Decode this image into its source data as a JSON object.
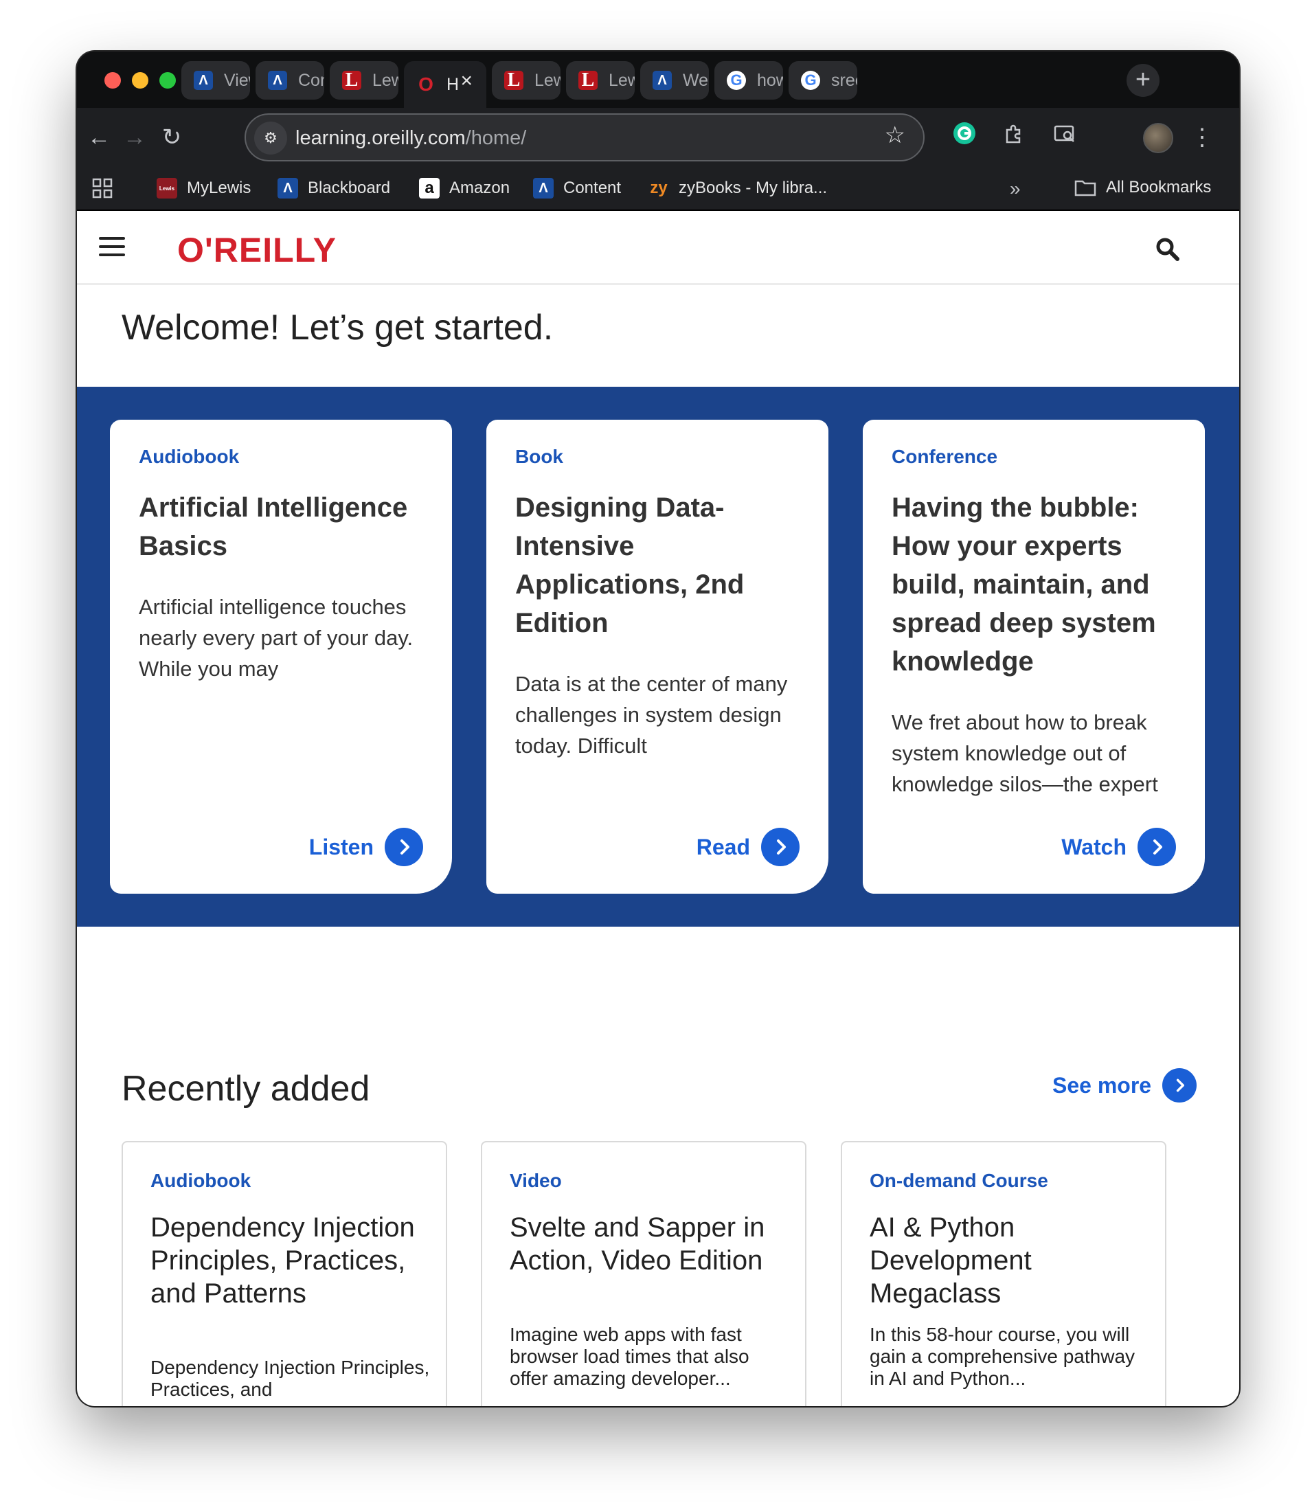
{
  "browser": {
    "tabs": [
      {
        "label": "View",
        "icon": "anthology-icon"
      },
      {
        "label": "Cont",
        "icon": "anthology-icon"
      },
      {
        "label": "Lewi",
        "icon": "lewis-icon"
      },
      {
        "label": "H",
        "icon": "oreilly-icon",
        "active": true
      },
      {
        "label": "Lewi",
        "icon": "lewis-icon"
      },
      {
        "label": "Lewi",
        "icon": "lewis-icon"
      },
      {
        "label": "Welc",
        "icon": "anthology-icon"
      },
      {
        "label": "how",
        "icon": "google-icon"
      },
      {
        "label": "sreer",
        "icon": "google-icon"
      }
    ],
    "url_host": "learning.oreilly.com",
    "url_path": "/home/",
    "bookmarks": [
      {
        "label": "MyLewis",
        "icon": "mylewis-icon"
      },
      {
        "label": "Blackboard",
        "icon": "anthology-icon"
      },
      {
        "label": "Amazon",
        "icon": "amazon-icon"
      },
      {
        "label": "Content",
        "icon": "anthology-icon"
      },
      {
        "label": "zyBooks - My libra...",
        "icon": "zybooks-icon"
      }
    ],
    "all_bookmarks_label": "All Bookmarks",
    "overflow_label": "»"
  },
  "site": {
    "logo": "O'REILLY",
    "welcome": "Welcome! Let’s get started."
  },
  "featured": [
    {
      "kind": "Audiobook",
      "title": "Artificial Intelligence Basics",
      "desc": "Artificial intelligence touches nearly every part of your day. While you may",
      "cta": "Listen"
    },
    {
      "kind": "Book",
      "title": "Designing Data-Intensive Applications, 2nd Edition",
      "desc": "Data is at the center of many challenges in system design today. Difficult",
      "cta": "Read"
    },
    {
      "kind": "Conference",
      "title": "Having the bubble: How your experts build, maintain, and spread deep system knowledge",
      "desc": "We fret about how to break system knowledge out of knowledge silos—the expert",
      "cta": "Watch"
    }
  ],
  "recent": {
    "title": "Recently added",
    "see_more": "See more",
    "items": [
      {
        "kind": "Audiobook",
        "title": "Dependency Injection Principles, Practices, and Patterns",
        "desc": "Dependency Injection Principles, Practices, and"
      },
      {
        "kind": "Video",
        "title": "Svelte and Sapper in Action, Video Edition",
        "desc": "Imagine web apps with fast browser load times that also offer amazing developer..."
      },
      {
        "kind": "On-demand Course",
        "title": "AI & Python Development Megaclass",
        "desc": "In this 58-hour course, you will gain a comprehensive pathway in AI and Python..."
      }
    ]
  },
  "colors": {
    "brand_red": "#d3212c",
    "hero_blue": "#1b438b",
    "link_blue": "#1a5fd6"
  }
}
